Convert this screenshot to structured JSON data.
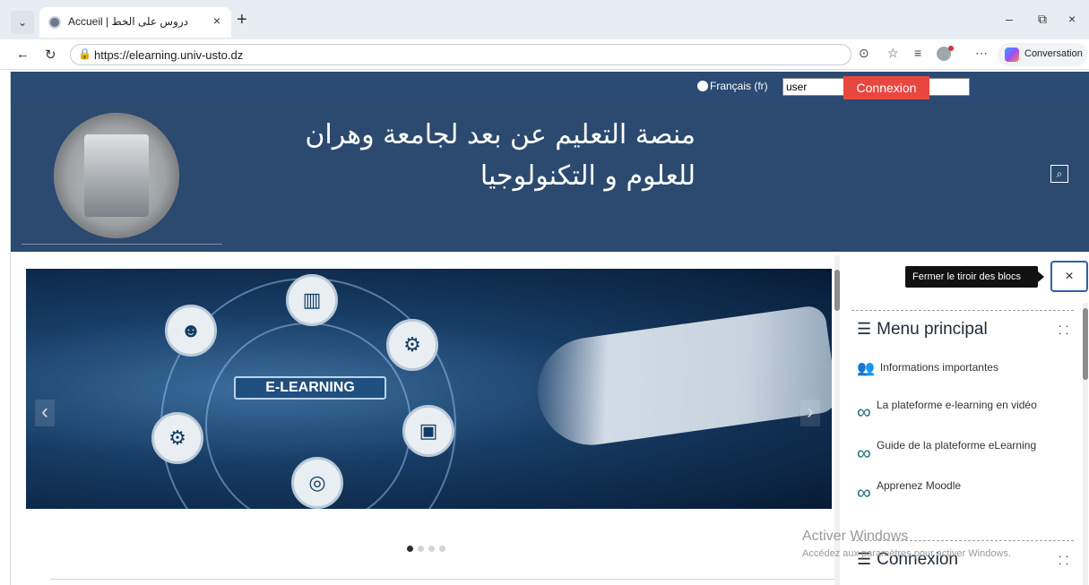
{
  "browser": {
    "tab_title": "Accueil | دروس على الخط",
    "tab_close": "×",
    "new_tab": "+",
    "url": "https://elearning.univ-usto.dz",
    "copilot_label": "Conversation",
    "minimize": "–",
    "restore": "⧉",
    "close": "×"
  },
  "topbar": {
    "language": "Français (fr)",
    "username_value": "user",
    "password_value": "••••••••",
    "login_button": "Connexion"
  },
  "header": {
    "site_title": "منصة التعليم عن بعد لجامعة وهران للعلوم و التكنولوجيا"
  },
  "slider": {
    "caption": "E-LEARNING",
    "prev": "‹",
    "next": "›",
    "active_slide": 1,
    "slide_count": 4
  },
  "drawer": {
    "tooltip": "Fermer le tiroir des blocs",
    "close_label": "×",
    "menu_title": "Menu principal",
    "menu_items": [
      "Informations importantes",
      "La plateforme e-learning en vidéo",
      "Guide de la plateforme eLearning",
      "Apprenez Moodle"
    ],
    "login_block_title": "Connexion"
  },
  "watermark": {
    "line1": "Activer Windows",
    "line2": "Accédez aux paramètres pour activer Windows."
  }
}
